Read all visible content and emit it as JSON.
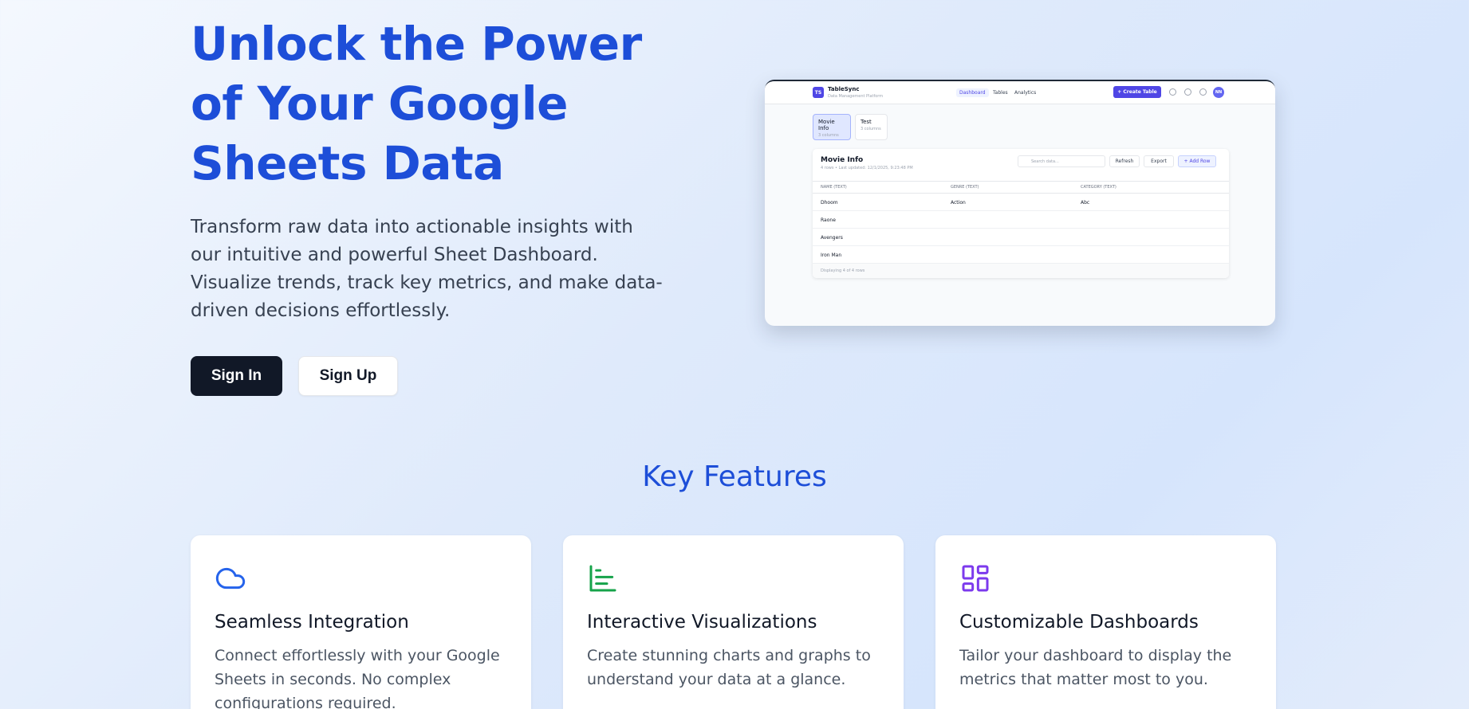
{
  "hero": {
    "title": "Unlock the Power of Your Google Sheets Data",
    "description": "Transform raw data into actionable insights with our intuitive and powerful Sheet Dashboard. Visualize trends, track key metrics, and make data-driven decisions effortlessly.",
    "signin_label": "Sign In",
    "signup_label": "Sign Up"
  },
  "preview": {
    "logo": "TS",
    "brand": "TableSync",
    "brand_sub": "Data Management Platform",
    "nav": [
      "Dashboard",
      "Tables",
      "Analytics"
    ],
    "create_label": "+ Create Table",
    "avatar": "NN",
    "tabs": [
      {
        "name": "Movie Info",
        "cols": "3 columns"
      },
      {
        "name": "Test",
        "cols": "3 columns"
      }
    ],
    "table_title": "Movie Info",
    "table_sub": "4 rows • Last updated: 12/1/2025, 9:23:48 PM",
    "search_placeholder": "Search data...",
    "refresh_label": "Refresh",
    "export_label": "Export",
    "addrow_label": "+ Add Row",
    "headers": [
      "NAME (TEXT)",
      "GENRE (TEXT)",
      "CATEGORY (TEXT)"
    ],
    "rows": [
      [
        "Dhoom",
        "Action",
        "Abc"
      ],
      [
        "Raone",
        "",
        ""
      ],
      [
        "Avengers",
        "",
        ""
      ],
      [
        "Iron Man",
        "",
        ""
      ]
    ],
    "footer": "Displaying 4 of 4 rows"
  },
  "features": {
    "title": "Key Features",
    "cards": [
      {
        "icon": "cloud-icon",
        "title": "Seamless Integration",
        "desc": "Connect effortlessly with your Google Sheets in seconds. No complex configurations required.",
        "color": "#2563eb"
      },
      {
        "icon": "bar-chart-icon",
        "title": "Interactive Visualizations",
        "desc": "Create stunning charts and graphs to understand your data at a glance.",
        "color": "#16a34a"
      },
      {
        "icon": "layout-dashboard-icon",
        "title": "Customizable Dashboards",
        "desc": "Tailor your dashboard to display the metrics that matter most to you.",
        "color": "#7c3aed"
      }
    ]
  },
  "colors": {
    "accent": "#1d4ed8",
    "dark_button": "#111827"
  }
}
